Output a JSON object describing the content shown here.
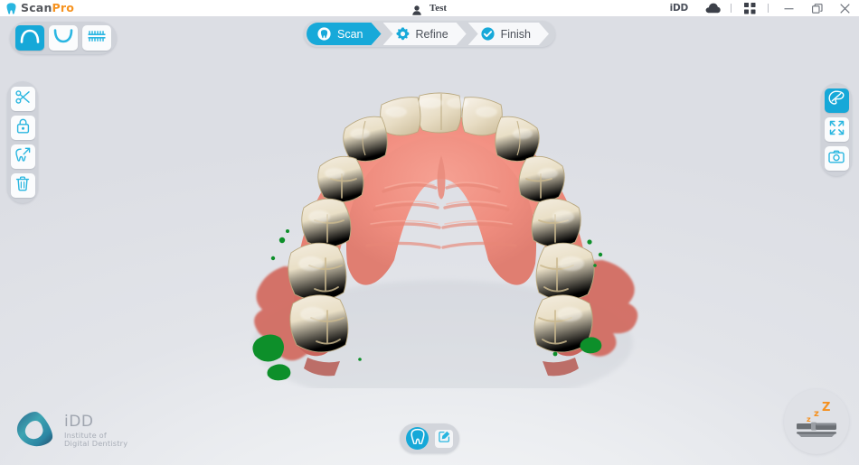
{
  "titlebar": {
    "logo_scan": "Scan",
    "logo_pro": "Pro",
    "logo_icon": "tooth-icon",
    "user_icon": "user-icon",
    "user_name": "Test",
    "idd_label": "iDD",
    "cloud_icon": "cloud-icon",
    "grid_icon": "grid-apps-icon",
    "minimize_icon": "minimize-icon",
    "restore_icon": "restore-window-icon",
    "close_icon": "close-icon"
  },
  "arch_toolbar": {
    "buttons": [
      {
        "name": "upper-arch",
        "icon": "upper-arch-icon",
        "active": true
      },
      {
        "name": "lower-arch",
        "icon": "lower-arch-icon",
        "active": false
      },
      {
        "name": "bite-occlusion",
        "icon": "bite-occlusion-icon",
        "active": false
      }
    ]
  },
  "stages": [
    {
      "label": "Scan",
      "icon": "scan-tooth-icon",
      "active": true
    },
    {
      "label": "Refine",
      "icon": "gear-icon",
      "active": false
    },
    {
      "label": "Finish",
      "icon": "check-circle-icon",
      "active": false
    }
  ],
  "left_tools": [
    {
      "name": "trim-scissors",
      "icon": "scissors-icon"
    },
    {
      "name": "lock",
      "icon": "lock-icon"
    },
    {
      "name": "tooth-edit",
      "icon": "tooth-arrow-icon"
    },
    {
      "name": "delete",
      "icon": "trash-icon"
    }
  ],
  "right_tools": [
    {
      "name": "color-mode",
      "icon": "palette-icon",
      "active": true
    },
    {
      "name": "fit-to-screen",
      "icon": "expand-arrows-icon",
      "active": false
    },
    {
      "name": "screenshot",
      "icon": "camera-icon",
      "active": false
    }
  ],
  "model": {
    "description": "Maxillary upper arch intraoral 3D scan",
    "arch": "upper",
    "gingiva_color": "#f0897e",
    "tooth_color": "#e8ddc4",
    "artifact_color": "#0d8f2a"
  },
  "brand": {
    "name": "iDD",
    "tagline_line1": "Institute of",
    "tagline_line2": "Digital Dentistry",
    "logo_icon": "idd-triangle-icon"
  },
  "bottom_controls": [
    {
      "name": "tooth-view-toggle",
      "icon": "tooth-circle-icon",
      "active": true
    },
    {
      "name": "annotate",
      "icon": "edit-square-icon",
      "active": false
    }
  ],
  "scanner_status": {
    "name": "scanner-sleep-indicator",
    "icon": "scanner-wand-sleep-icon",
    "state_text": "zZz",
    "accent_color": "#f5901e"
  },
  "colors": {
    "accent": "#16a8d8",
    "brand_orange": "#f6921e",
    "titlebar_bg": "#ffffff",
    "viewport_bg": "#dcdee4",
    "rail_bg": "#cfd2d9"
  }
}
